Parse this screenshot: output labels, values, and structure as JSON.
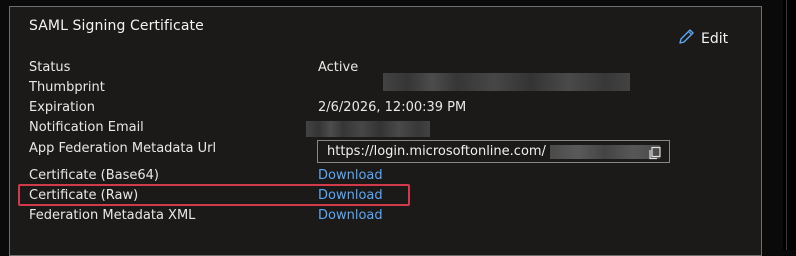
{
  "card": {
    "title": "SAML Signing Certificate",
    "edit_label": "Edit"
  },
  "fields": {
    "status_label": "Status",
    "status_value": "Active",
    "thumbprint_label": "Thumbprint",
    "expiration_label": "Expiration",
    "expiration_value": "2/6/2026, 12:00:39 PM",
    "notification_label": "Notification Email",
    "metadata_url_label": "App Federation Metadata Url",
    "metadata_url_value": "https://login.microsoftonline.com/",
    "cert_base64_label": "Certificate (Base64)",
    "cert_base64_link": "Download",
    "cert_raw_label": "Certificate (Raw)",
    "cert_raw_link": "Download",
    "fed_xml_label": "Federation Metadata XML",
    "fed_xml_link": "Download"
  },
  "icons": {
    "edit": "pencil-icon",
    "copy": "copy-icon"
  },
  "colors": {
    "link": "#5ba8f5",
    "highlight": "#d13a4a",
    "card_bg": "#1b1a19"
  }
}
